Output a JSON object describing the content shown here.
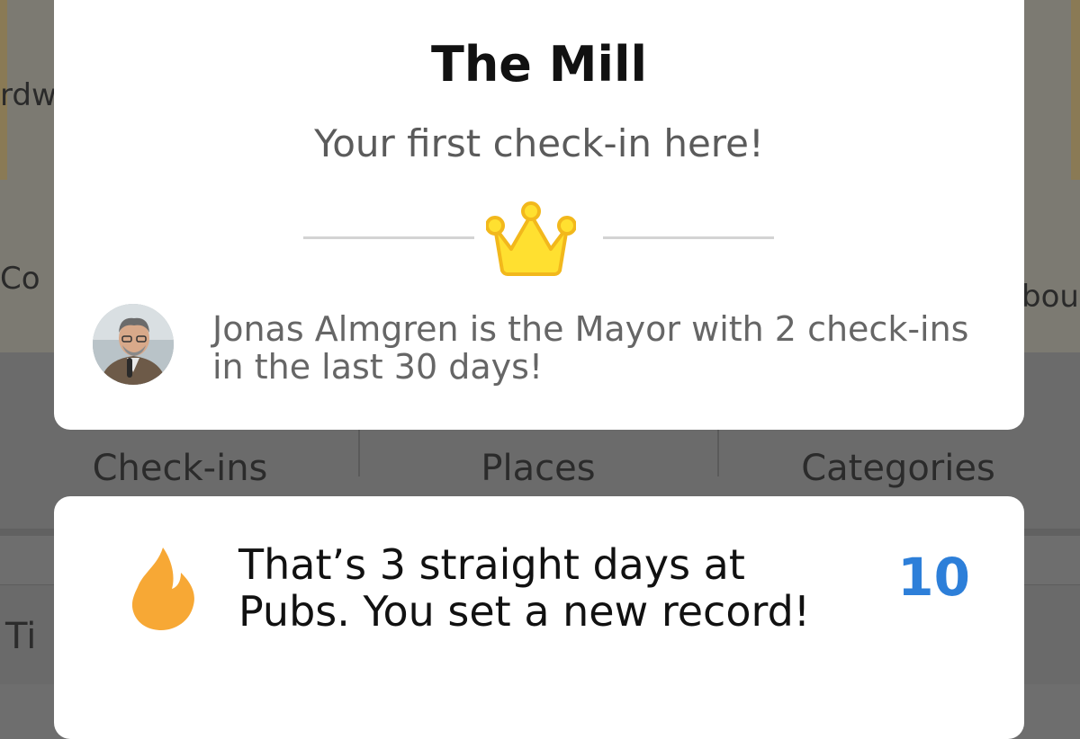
{
  "background": {
    "map_labels": {
      "left_top": "rdw",
      "left_mid": "Co",
      "right_mid": "bou"
    },
    "stats": [
      {
        "label": "Check-ins"
      },
      {
        "label": "Places"
      },
      {
        "label": "Categories"
      }
    ],
    "row_label": "Ti"
  },
  "mayor_card": {
    "venue_name": "The Mill",
    "subtitle": "Your first check-in here!",
    "crown_icon": "crown-icon",
    "mayor_message": "Jonas Almgren is the Mayor with 2 check-ins in the last 30 days!"
  },
  "streak_card": {
    "message": "That’s 3 straight days at Pubs. You set a new record!",
    "points": "10",
    "flame_icon": "flame-icon"
  },
  "colors": {
    "crown_fill": "#FFE030",
    "crown_stroke": "#F2B81C",
    "flame": "#F7A835",
    "points": "#2D7FD9"
  }
}
